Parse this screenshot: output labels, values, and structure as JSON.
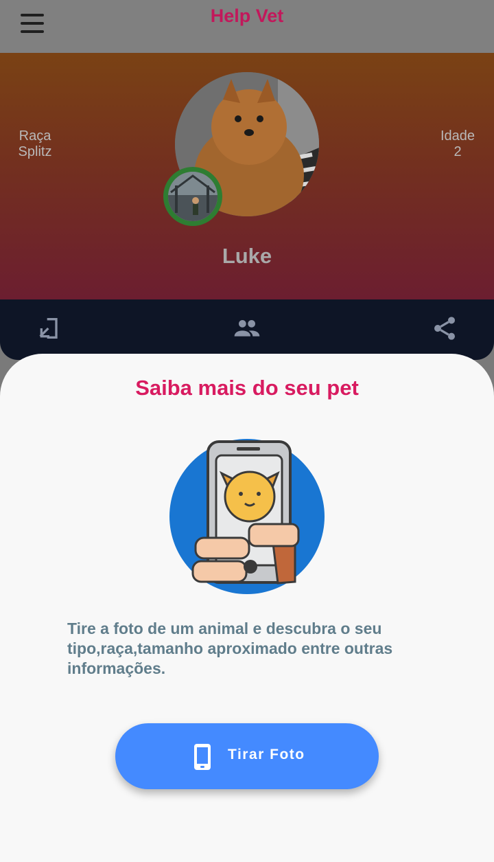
{
  "app": {
    "title": "Help Vet"
  },
  "icons": {
    "menu": "menu-icon",
    "login": "login-icon",
    "group": "group-icon",
    "share": "share-icon",
    "phone": "smartphone-icon"
  },
  "colors": {
    "title": "#c2185b",
    "sheet_title": "#d81b60",
    "button": "#448aff",
    "avatar_ring": "#2e7d32",
    "action_bar": "#0e1526"
  },
  "profile": {
    "breed_label": "Raça",
    "breed_value": "Splitz",
    "age_label": "Idade",
    "age_value": "2",
    "name": "Luke"
  },
  "sheet": {
    "title": "Saiba mais do seu pet",
    "description": "Tire a foto de um animal e descubra o seu tipo,raça,tamanho aproximado entre outras informações.",
    "button_label": "Tirar Foto"
  }
}
